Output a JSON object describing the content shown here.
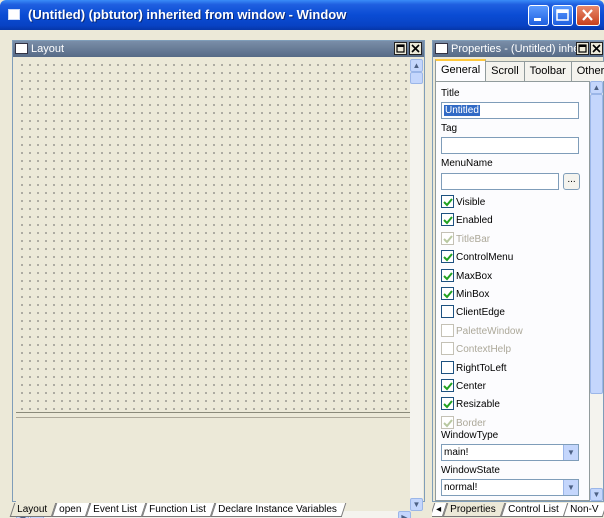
{
  "window": {
    "title": "(Untitled) (pbtutor) inherited from window - Window"
  },
  "layout_panel": {
    "title": "Layout"
  },
  "layout_tabs": [
    {
      "label": "Layout"
    },
    {
      "label": "open"
    },
    {
      "label": "Event List"
    },
    {
      "label": "Function List"
    },
    {
      "label": "Declare Instance Variables"
    }
  ],
  "properties_panel": {
    "title": "Properties - (Untitled) inhe",
    "tabs": [
      {
        "label": "General"
      },
      {
        "label": "Scroll"
      },
      {
        "label": "Toolbar"
      },
      {
        "label": "Other"
      }
    ],
    "title_label": "Title",
    "title_value": "Untitled",
    "tag_label": "Tag",
    "tag_value": "",
    "menuname_label": "MenuName",
    "menuname_value": "",
    "ellipsis_label": "...",
    "checkboxes": [
      {
        "label": "Visible",
        "checked": true,
        "enabled": true
      },
      {
        "label": "Enabled",
        "checked": true,
        "enabled": true
      },
      {
        "label": "TitleBar",
        "checked": true,
        "enabled": false
      },
      {
        "label": "ControlMenu",
        "checked": true,
        "enabled": true
      },
      {
        "label": "MaxBox",
        "checked": true,
        "enabled": true
      },
      {
        "label": "MinBox",
        "checked": true,
        "enabled": true
      },
      {
        "label": "ClientEdge",
        "checked": false,
        "enabled": true
      },
      {
        "label": "PaletteWindow",
        "checked": false,
        "enabled": false
      },
      {
        "label": "ContextHelp",
        "checked": false,
        "enabled": false
      },
      {
        "label": "RightToLeft",
        "checked": false,
        "enabled": true
      },
      {
        "label": "Center",
        "checked": true,
        "enabled": true
      },
      {
        "label": "Resizable",
        "checked": true,
        "enabled": true
      },
      {
        "label": "Border",
        "checked": true,
        "enabled": false
      }
    ],
    "windowtype_label": "WindowType",
    "windowtype_value": "main!",
    "windowstate_label": "WindowState",
    "windowstate_value": "normal!"
  },
  "properties_bottom_tabs": [
    {
      "label": "Properties"
    },
    {
      "label": "Control List"
    },
    {
      "label": "Non-V"
    }
  ],
  "colors": {
    "titlebar": "#0a4cd4",
    "panel_title": "#566a86",
    "selection": "#316ac5"
  }
}
